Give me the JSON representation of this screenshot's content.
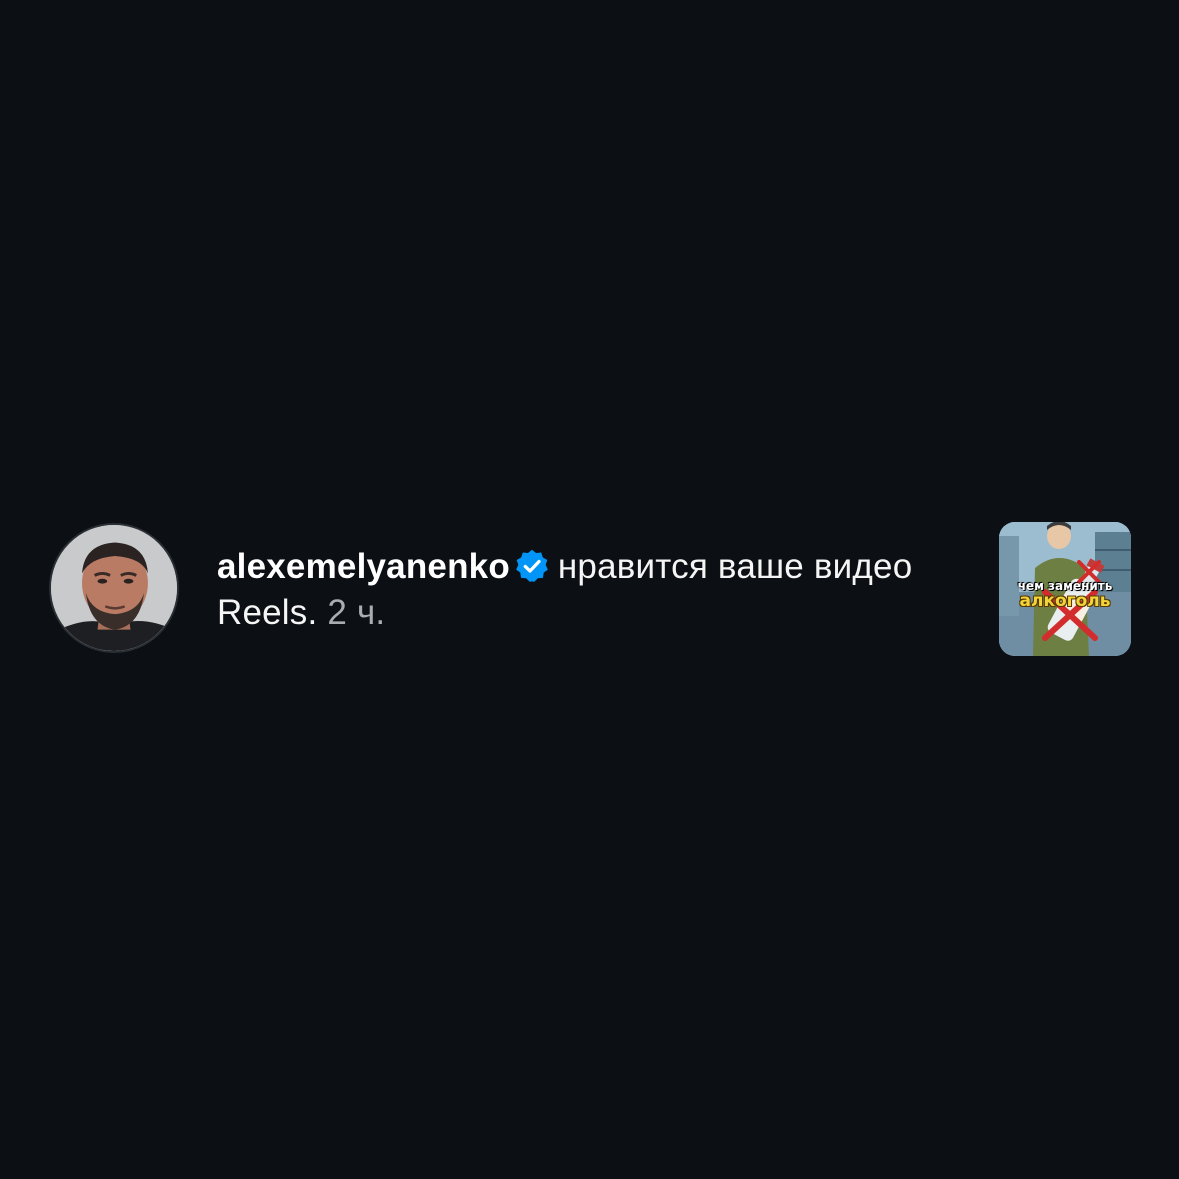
{
  "notification": {
    "username": "alexemelyanenko",
    "verified": true,
    "action_text": "нравится ваше видео Reels.",
    "time": "2 ч.",
    "thumbnail": {
      "line1": "чем заменить",
      "line2": "алкоголь"
    }
  },
  "colors": {
    "background": "#0c1014",
    "text": "#f5f5f5",
    "muted": "#a8adb3",
    "verified_badge": "#0095f6"
  },
  "icons": {
    "verified": "verified-badge-icon",
    "avatar": "user-avatar",
    "thumbnail": "reel-thumbnail"
  }
}
